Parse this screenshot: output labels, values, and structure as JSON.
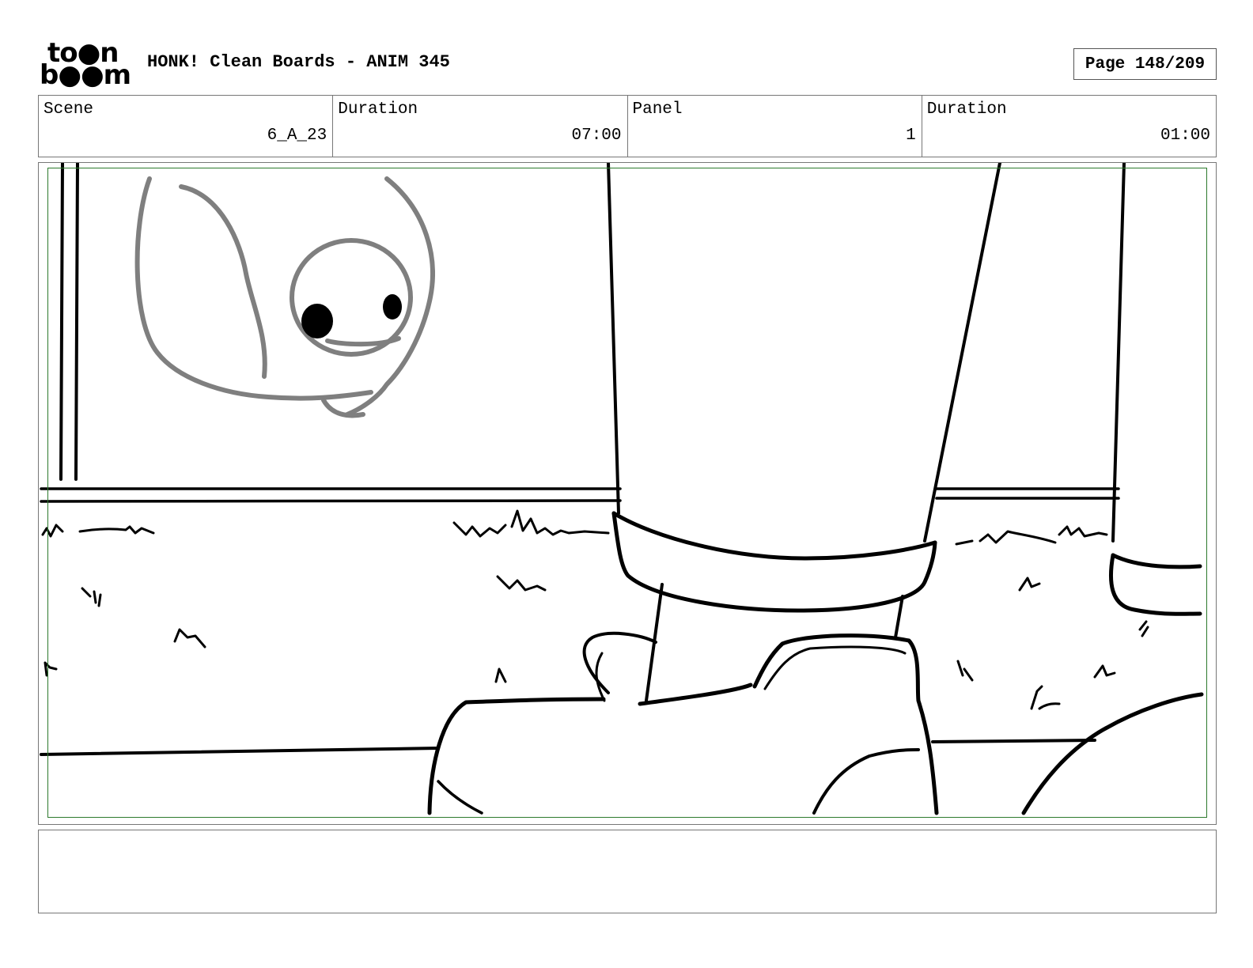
{
  "header": {
    "logo": {
      "line1": "to●n",
      "line2": "b●●m",
      "alt": "toon boom"
    },
    "title": "HONK! Clean Boards - ANIM 345",
    "page_label": "Page 148/209"
  },
  "info": {
    "scene_label": "Scene",
    "scene_value": "6_A_23",
    "scene_duration_label": "Duration",
    "scene_duration_value": "07:00",
    "panel_label": "Panel",
    "panel_value": "1",
    "panel_duration_label": "Duration",
    "panel_duration_value": "01:00"
  },
  "panel": {
    "safe_frame_color": "#2d7a2d",
    "drawing": "storyboard-sketch"
  },
  "notes": {
    "text": ""
  }
}
